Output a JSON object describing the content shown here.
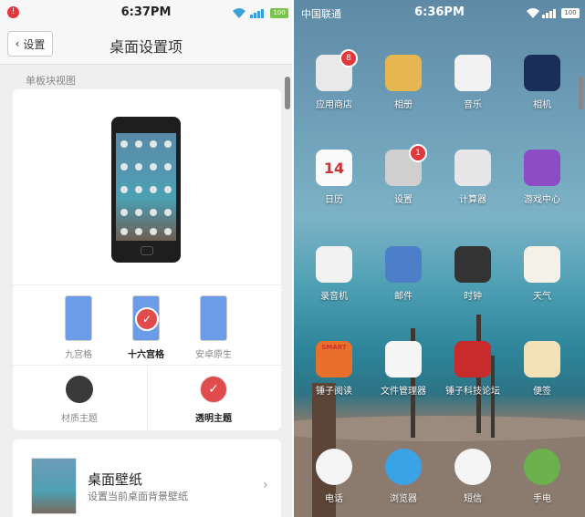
{
  "left": {
    "status": {
      "time": "6:37PM",
      "battery": "100"
    },
    "header": {
      "back_label": "设置",
      "title": "桌面设置项"
    },
    "section_label": "单板块视图",
    "grid_options": [
      {
        "label": "九宫格",
        "selected": false
      },
      {
        "label": "十六宫格",
        "selected": true
      },
      {
        "label": "安卓原生",
        "selected": false
      }
    ],
    "theme_options": [
      {
        "label": "材质主题",
        "selected": false
      },
      {
        "label": "透明主题",
        "selected": true
      }
    ],
    "wallpaper": {
      "title": "桌面壁纸",
      "subtitle": "设置当前桌面背景壁纸"
    }
  },
  "right": {
    "status": {
      "carrier": "中国联通",
      "time": "6:36PM",
      "battery": "100"
    },
    "apps": [
      {
        "label": "应用商店",
        "icon": "app-store-icon",
        "badge": "8",
        "color": "#e9e9e9"
      },
      {
        "label": "相册",
        "icon": "gallery-icon",
        "color": "#e8b650"
      },
      {
        "label": "音乐",
        "icon": "music-icon",
        "color": "#f2f2f2"
      },
      {
        "label": "相机",
        "icon": "camera-icon",
        "color": "#1a2e5a"
      },
      {
        "label": "日历",
        "icon": "calendar-icon",
        "color": "#fafafa",
        "text": "14"
      },
      {
        "label": "设置",
        "icon": "settings-icon",
        "badge": "1",
        "color": "#cfcfcf"
      },
      {
        "label": "计算器",
        "icon": "calculator-icon",
        "color": "#e6e6e6"
      },
      {
        "label": "游戏中心",
        "icon": "game-center-icon",
        "color": "#8d4bc4"
      },
      {
        "label": "录音机",
        "icon": "recorder-icon",
        "color": "#f2f2f2"
      },
      {
        "label": "邮件",
        "icon": "mail-icon",
        "color": "#4d7fc9"
      },
      {
        "label": "时钟",
        "icon": "clock-icon",
        "color": "#333333"
      },
      {
        "label": "天气",
        "icon": "weather-icon",
        "color": "#f4f1e8"
      },
      {
        "label": "锤子阅读",
        "icon": "reader-icon",
        "color": "#e8702a",
        "text": "SMART"
      },
      {
        "label": "文件管理器",
        "icon": "file-manager-icon",
        "color": "#f5f5f5"
      },
      {
        "label": "锤子科技论坛",
        "icon": "forum-icon",
        "color": "#c82b2b"
      },
      {
        "label": "便签",
        "icon": "notes-icon",
        "color": "#f3e2b8"
      }
    ],
    "dock": [
      {
        "label": "电话",
        "icon": "phone-icon",
        "color": "#f5f5f5"
      },
      {
        "label": "浏览器",
        "icon": "browser-icon",
        "color": "#3aa3e6"
      },
      {
        "label": "短信",
        "icon": "messages-icon",
        "color": "#f5f5f5"
      },
      {
        "label": "手电",
        "icon": "flashlight-icon",
        "color": "#6ab04c"
      }
    ]
  }
}
